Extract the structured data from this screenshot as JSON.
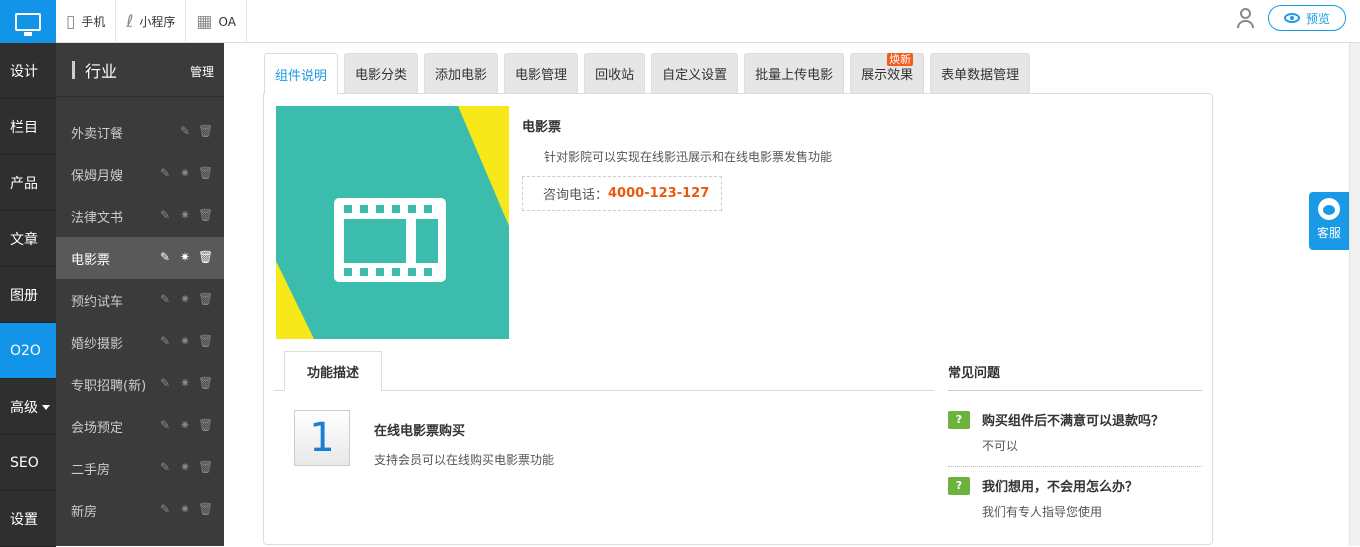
{
  "topnav": {
    "items": [
      {
        "label": "手机",
        "icon": "phone-icon"
      },
      {
        "label": "小程序",
        "icon": "mini-program-icon"
      },
      {
        "label": "OA",
        "icon": "calendar-icon"
      }
    ],
    "preview_label": "预览"
  },
  "rail": {
    "items": [
      "设计",
      "栏目",
      "产品",
      "文章",
      "图册",
      "O2O",
      "高级",
      "SEO",
      "设置"
    ],
    "active": "O2O"
  },
  "subnav": {
    "title": "行业",
    "manage": "管理",
    "items": [
      "外卖订餐",
      "保姆月嫂",
      "法律文书",
      "电影票",
      "预约试车",
      "婚纱摄影",
      "专职招聘(新)",
      "会场预定",
      "二手房",
      "新房"
    ],
    "active": "电影票"
  },
  "tabs": [
    {
      "label": "组件说明"
    },
    {
      "label": "电影分类"
    },
    {
      "label": "添加电影"
    },
    {
      "label": "电影管理"
    },
    {
      "label": "回收站"
    },
    {
      "label": "自定义设置"
    },
    {
      "label": "批量上传电影"
    },
    {
      "label": "展示效果",
      "badge": "焕新"
    },
    {
      "label": "表单数据管理"
    }
  ],
  "component": {
    "title": "电影票",
    "desc": "针对影院可以实现在线影迅展示和在线电影票发售功能",
    "phone_label": "咨询电话：",
    "phone": "4000-123-127",
    "banner_color": "#3bbcad",
    "banner_accent": "#f7e81a"
  },
  "function": {
    "tab": "功能描述",
    "number": "1",
    "title": "在线电影票购买",
    "desc": "支持会员可以在线购买电影票功能"
  },
  "faq": {
    "title": "常见问题",
    "items": [
      {
        "q": "购买组件后不满意可以退款吗？",
        "a": "不可以"
      },
      {
        "q": "我们想用，不会用怎么办？",
        "a": "我们有专人指导您使用"
      }
    ]
  },
  "kefu": {
    "label": "客服"
  }
}
